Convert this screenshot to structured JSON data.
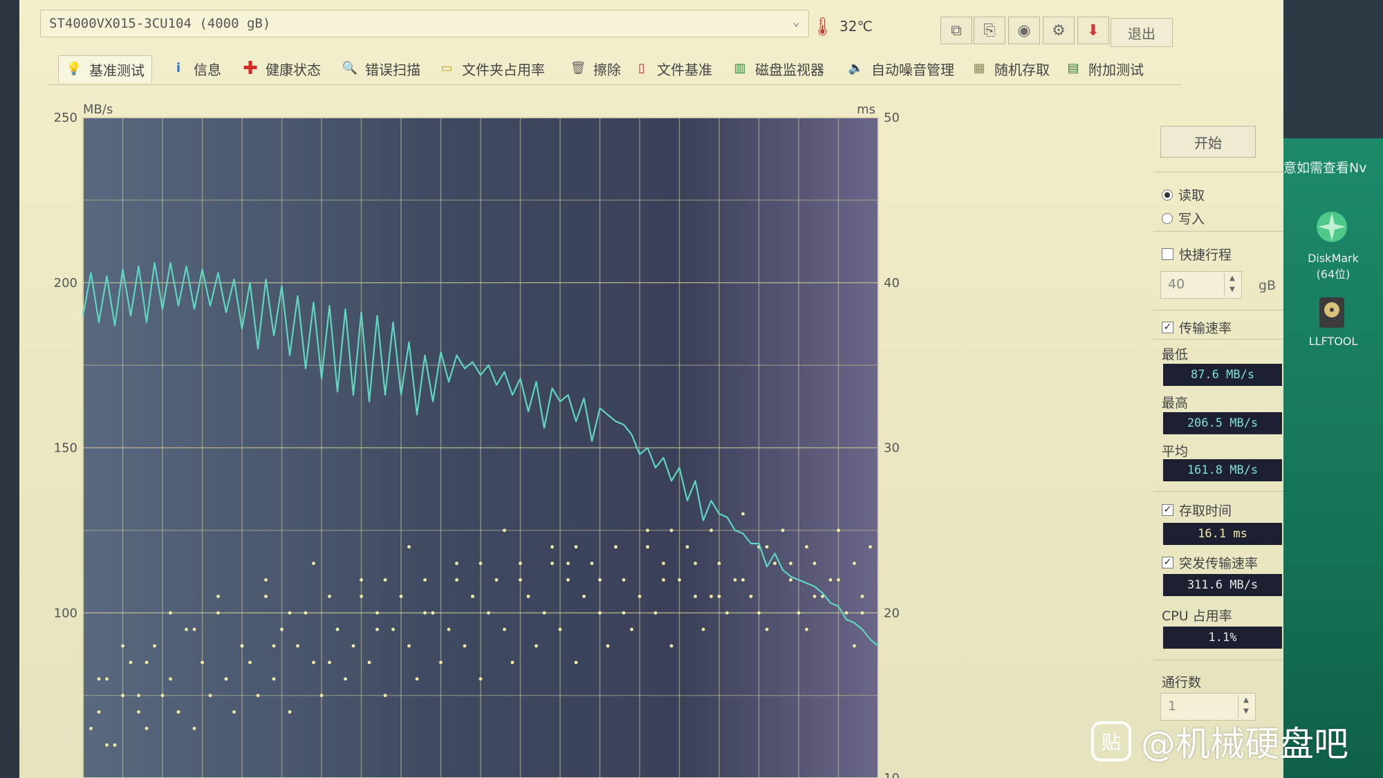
{
  "drive": {
    "name": "ST4000VX015-3CU104 (4000 gB)"
  },
  "temperature": "32℃",
  "toolbar": {
    "exit_label": "退出"
  },
  "tabs": [
    {
      "label": "基准测试",
      "icon": "lightbulb-icon"
    },
    {
      "label": "信息",
      "icon": "info-icon"
    },
    {
      "label": "健康状态",
      "icon": "health-cross-icon"
    },
    {
      "label": "错误扫描",
      "icon": "magnifier-icon"
    },
    {
      "label": "文件夹占用率",
      "icon": "folder-icon"
    },
    {
      "label": "擦除",
      "icon": "trash-icon"
    },
    {
      "label": "文件基准",
      "icon": "file-benchmark-icon"
    },
    {
      "label": "磁盘监视器",
      "icon": "disk-monitor-icon"
    },
    {
      "label": "自动噪音管理",
      "icon": "speaker-icon"
    },
    {
      "label": "随机存取",
      "icon": "random-access-icon"
    },
    {
      "label": "附加测试",
      "icon": "extra-tests-icon"
    }
  ],
  "panel": {
    "start_label": "开始",
    "read_label": "读取",
    "write_label": "写入",
    "quick_label": "快捷行程",
    "quick_value": "40",
    "quick_unit": "gB",
    "transfer_label": "传输速率",
    "min_label": "最低",
    "min_value": "87.6 MB/s",
    "max_label": "最高",
    "max_value": "206.5 MB/s",
    "avg_label": "平均",
    "avg_value": "161.8 MB/s",
    "access_label": "存取时间",
    "access_value": "16.1 ms",
    "burst_label": "突发传输速率",
    "burst_value": "311.6 MB/s",
    "cpu_label": "CPU 占用率",
    "cpu_value": "1.1%",
    "passes_label": "通行数",
    "passes_value": "1"
  },
  "desktop": {
    "banner": "意如需查看Nv",
    "icons": [
      {
        "label": "DiskMark\n(64位)",
        "icon": "diskmark-icon"
      },
      {
        "label": "LLFTOOL",
        "icon": "llftool-icon"
      }
    ]
  },
  "watermark": {
    "text": "@机械硬盘吧",
    "icon": "tieba-icon",
    "icon_glyph": "贴"
  },
  "chart_data": {
    "type": "line",
    "y_left_unit": "MB/s",
    "y_right_unit": "ms",
    "y_left_ticks": [
      "250",
      "200",
      "150",
      "100"
    ],
    "y_right_ticks": [
      "50",
      "40",
      "30",
      "20",
      "10"
    ],
    "y_left_range": [
      50,
      250
    ],
    "y_right_range": [
      10,
      50
    ],
    "x_range": [
      0,
      100
    ],
    "grid": true,
    "colors": {
      "transfer": "#5fd6c1",
      "access": "#f2eca6",
      "background": "#4d5a70"
    },
    "series": [
      {
        "kind": "transfer_rate",
        "x": [
          0,
          1,
          2,
          3,
          4,
          5,
          6,
          7,
          8,
          9,
          10,
          11,
          12,
          13,
          14,
          15,
          16,
          17,
          18,
          19,
          20,
          21,
          22,
          23,
          24,
          25,
          26,
          27,
          28,
          29,
          30,
          31,
          32,
          33,
          34,
          35,
          36,
          37,
          38,
          39,
          40,
          41,
          42,
          43,
          44,
          45,
          46,
          47,
          48,
          49,
          50,
          51,
          52,
          53,
          54,
          55,
          56,
          57,
          58,
          59,
          60,
          61,
          62,
          63,
          64,
          65,
          66,
          67,
          68,
          69,
          70,
          71,
          72,
          73,
          74,
          75,
          76,
          77,
          78,
          79,
          80,
          81,
          82,
          83,
          84,
          85,
          86,
          87,
          88,
          89,
          90,
          91,
          92,
          93,
          94,
          95,
          96,
          97,
          98,
          99,
          100
        ],
        "y": [
          190,
          203,
          188,
          202,
          187,
          204,
          190,
          205,
          188,
          206,
          192,
          206,
          193,
          205,
          192,
          204,
          193,
          203,
          191,
          201,
          186,
          200,
          180,
          201,
          184,
          199,
          178,
          196,
          174,
          194,
          171,
          193,
          167,
          192,
          166,
          191,
          164,
          190,
          166,
          188,
          166,
          182,
          160,
          178,
          164,
          179,
          170,
          178,
          174,
          176,
          172,
          175,
          169,
          173,
          166,
          171,
          161,
          170,
          156,
          168,
          164,
          166,
          158,
          165,
          152,
          162,
          160,
          158,
          157,
          154,
          148,
          150,
          144,
          147,
          140,
          144,
          134,
          140,
          128,
          134,
          130,
          129,
          125,
          124,
          121,
          121,
          114,
          118,
          113,
          111,
          110,
          109,
          108,
          106,
          103,
          102,
          98,
          97,
          95,
          92,
          90
        ]
      },
      {
        "kind": "access_time",
        "x": [
          1,
          2,
          3,
          4,
          5,
          6,
          7,
          8,
          9,
          10,
          11,
          12,
          13,
          14,
          15,
          16,
          17,
          18,
          19,
          20,
          21,
          22,
          23,
          24,
          25,
          26,
          27,
          28,
          29,
          30,
          31,
          32,
          33,
          34,
          35,
          36,
          37,
          38,
          39,
          40,
          41,
          42,
          43,
          44,
          45,
          46,
          47,
          48,
          49,
          50,
          51,
          52,
          53,
          54,
          55,
          56,
          57,
          58,
          59,
          60,
          61,
          62,
          63,
          64,
          65,
          66,
          67,
          68,
          69,
          70,
          71,
          72,
          73,
          74,
          75,
          76,
          77,
          78,
          79,
          80,
          81,
          82,
          83,
          84,
          85,
          86,
          87,
          88,
          89,
          90,
          91,
          92,
          93,
          94,
          95,
          96,
          97,
          98,
          99,
          2,
          5,
          8,
          11,
          14,
          17,
          20,
          23,
          26,
          29,
          32,
          35,
          38,
          41,
          44,
          47,
          50,
          53,
          56,
          59,
          62,
          65,
          68,
          71,
          74,
          77,
          80,
          83,
          86,
          89,
          92,
          95,
          98,
          3,
          7,
          12,
          18,
          24,
          31,
          37,
          43,
          49,
          55,
          61,
          67,
          73,
          79,
          85,
          91,
          97
        ],
        "y": [
          13,
          14,
          16,
          12,
          15,
          17,
          14,
          13,
          18,
          15,
          16,
          14,
          19,
          13,
          17,
          15,
          20,
          16,
          14,
          18,
          17,
          15,
          21,
          16,
          19,
          14,
          18,
          20,
          17,
          15,
          21,
          19,
          16,
          18,
          22,
          17,
          20,
          15,
          19,
          21,
          18,
          16,
          22,
          20,
          17,
          19,
          23,
          18,
          21,
          16,
          20,
          22,
          19,
          17,
          23,
          21,
          18,
          20,
          24,
          19,
          22,
          17,
          21,
          23,
          20,
          18,
          24,
          22,
          19,
          21,
          25,
          20,
          23,
          18,
          22,
          24,
          21,
          19,
          25,
          23,
          20,
          22,
          26,
          21,
          24,
          19,
          23,
          25,
          22,
          20,
          24,
          23,
          21,
          22,
          25,
          20,
          23,
          21,
          24,
          16,
          18,
          17,
          20,
          19,
          21,
          18,
          22,
          20,
          23,
          19,
          21,
          22,
          24,
          20,
          22,
          23,
          25,
          21,
          23,
          24,
          22,
          20,
          24,
          25,
          23,
          21,
          22,
          24,
          23,
          21,
          22,
          20,
          12,
          15,
          14,
          16,
          18,
          17,
          19,
          20,
          21,
          22,
          23,
          24,
          22,
          21,
          20,
          19,
          18
        ]
      }
    ]
  }
}
